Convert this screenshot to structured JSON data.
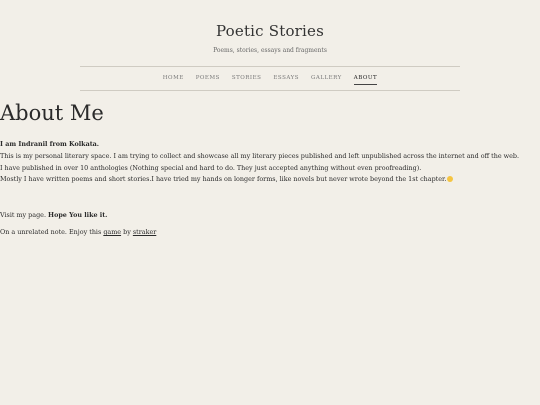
{
  "site": {
    "title": "Poetic Stories",
    "tagline": "Poems, stories, essays and fragments"
  },
  "nav": {
    "items": [
      "HOME",
      "POEMS",
      "STORIES",
      "ESSAYS",
      "GALLERY",
      "ABOUT"
    ],
    "active": "ABOUT"
  },
  "page": {
    "title": "About Me",
    "intro": "I am Indranil from Kolkata.",
    "line1": "This is my personal literary space. I am trying to collect and showcase all my literary pieces published and left unpublished across the internet and off the web.",
    "line2": "I have published in over 10 anthologies (Nothing special and hard to do. They just accepted anything without even proofreading).",
    "line3": "Mostly I have written poems and short stories.I have tried my hands on longer forms, like novels but never wrote beyond the 1st chapter.",
    "emoji_icon": "grinning-face-sweat-icon",
    "visit_prefix": "Visit my page.",
    "visit_bold": "Hope You like it.",
    "note_prefix": "On a unrelated note. Enjoy this",
    "game_link": "game",
    "by_text": "by",
    "author_link": "straker"
  }
}
